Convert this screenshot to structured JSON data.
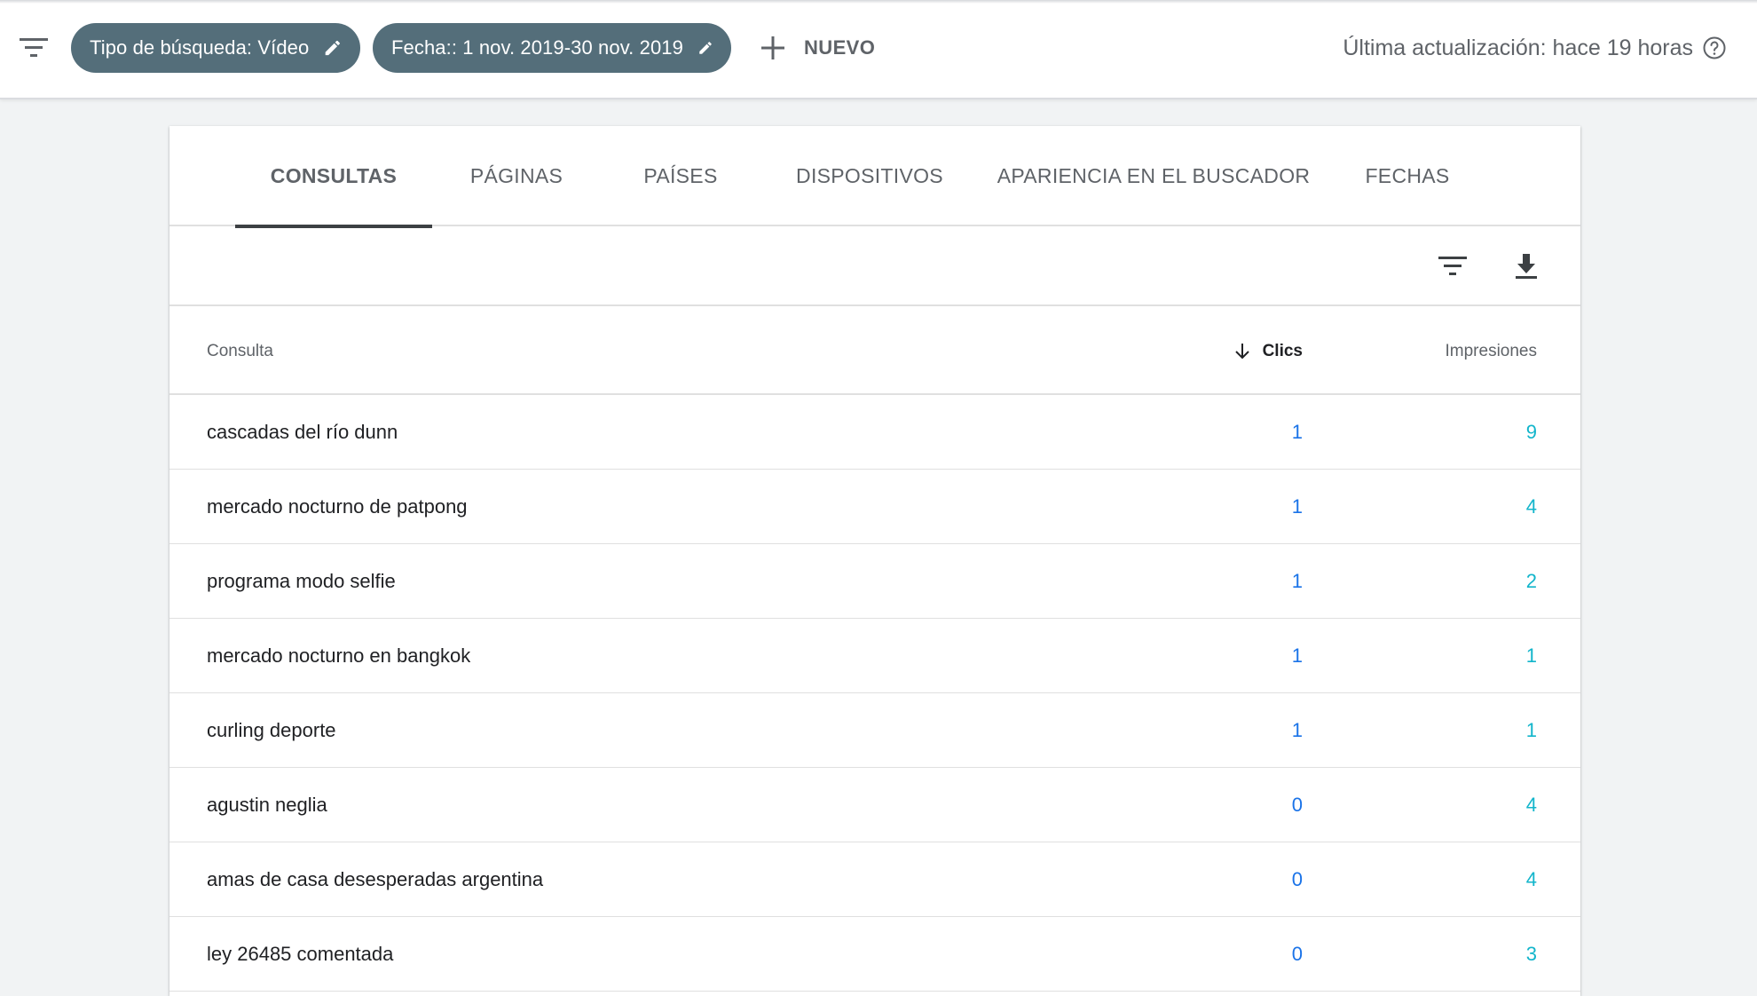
{
  "topbar": {
    "chips": [
      {
        "label": "Tipo de búsqueda: Vídeo"
      },
      {
        "label": "Fecha:: 1 nov. 2019-30 nov. 2019"
      }
    ],
    "new_label": "NUEVO",
    "last_update": "Última actualización: hace 19 horas"
  },
  "tabs": [
    {
      "label": "CONSULTAS",
      "active": true
    },
    {
      "label": "PÁGINAS",
      "active": false
    },
    {
      "label": "PAÍSES",
      "active": false
    },
    {
      "label": "DISPOSITIVOS",
      "active": false
    },
    {
      "label": "APARIENCIA EN EL BUSCADOR",
      "active": false
    },
    {
      "label": "FECHAS",
      "active": false
    }
  ],
  "table": {
    "columns": {
      "query": "Consulta",
      "clicks": "Clics",
      "impressions": "Impresiones"
    },
    "sort": {
      "column": "clicks",
      "direction": "descending"
    },
    "rows": [
      {
        "query": "cascadas del río dunn",
        "clicks": "1",
        "impressions": "9"
      },
      {
        "query": "mercado nocturno de patpong",
        "clicks": "1",
        "impressions": "4"
      },
      {
        "query": "programa modo selfie",
        "clicks": "1",
        "impressions": "2"
      },
      {
        "query": "mercado nocturno en bangkok",
        "clicks": "1",
        "impressions": "1"
      },
      {
        "query": "curling deporte",
        "clicks": "1",
        "impressions": "1"
      },
      {
        "query": "agustin neglia",
        "clicks": "0",
        "impressions": "4"
      },
      {
        "query": "amas de casa desesperadas argentina",
        "clicks": "0",
        "impressions": "4"
      },
      {
        "query": "ley 26485 comentada",
        "clicks": "0",
        "impressions": "3"
      }
    ]
  },
  "icons": {
    "filter": "filter-list-icon",
    "edit": "pencil-icon",
    "add": "plus-icon",
    "help": "help-circle-icon",
    "download": "download-icon",
    "sort": "arrow-down-icon"
  },
  "colors": {
    "chip_bg": "#546e7a",
    "clicks": "#1a73e8",
    "impressions": "#12b5cb",
    "tab_indicator": "#3c4043"
  }
}
